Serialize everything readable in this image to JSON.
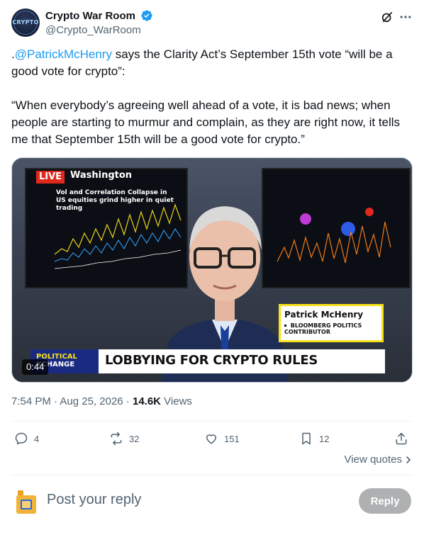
{
  "author": {
    "display_name": "Crypto War Room",
    "handle": "@Crypto_WarRoom",
    "avatar_text": "CRYPTO",
    "verified_icon": "verified-badge-icon",
    "accent_color": "#1d9bf0"
  },
  "tweet": {
    "prefix": ".",
    "mention": "@PatrickMcHenry",
    "line1_rest": " says the Clarity Act’s September 15th vote “will be a good vote for crypto”:",
    "quote": "“When everybody’s agreeing well ahead of a vote, it is bad news; when people are starting to murmur and complain, as they are right now, it tells me that September 15th will be a good vote for crypto.”"
  },
  "media": {
    "live_label": "LIVE",
    "live_location": "Washington",
    "chart_title_line1": "Vol and Correlation Collapse in",
    "chart_title_line2": "US equities grind higher in quiet trading",
    "namecard_name": "Patrick McHenry",
    "namecard_title_line1": "BLOOMBERG POLITICS",
    "namecard_title_line2": "CONTRIBUTOR",
    "segment_word1": "POLITICAL",
    "segment_word2": "XCHANGE",
    "headline": "LOBBYING FOR CRYPTO RULES",
    "duration": "0:44"
  },
  "meta": {
    "time": "7:54 PM",
    "separator": " · ",
    "date": "Aug 25, 2026",
    "views_count": "14.6K",
    "views_label": " Views"
  },
  "actions": {
    "replies": "4",
    "reposts": "32",
    "likes": "151",
    "bookmarks": "12",
    "view_quotes": "View quotes"
  },
  "reply_bar": {
    "placeholder": "Post your reply",
    "button_label": "Reply"
  }
}
